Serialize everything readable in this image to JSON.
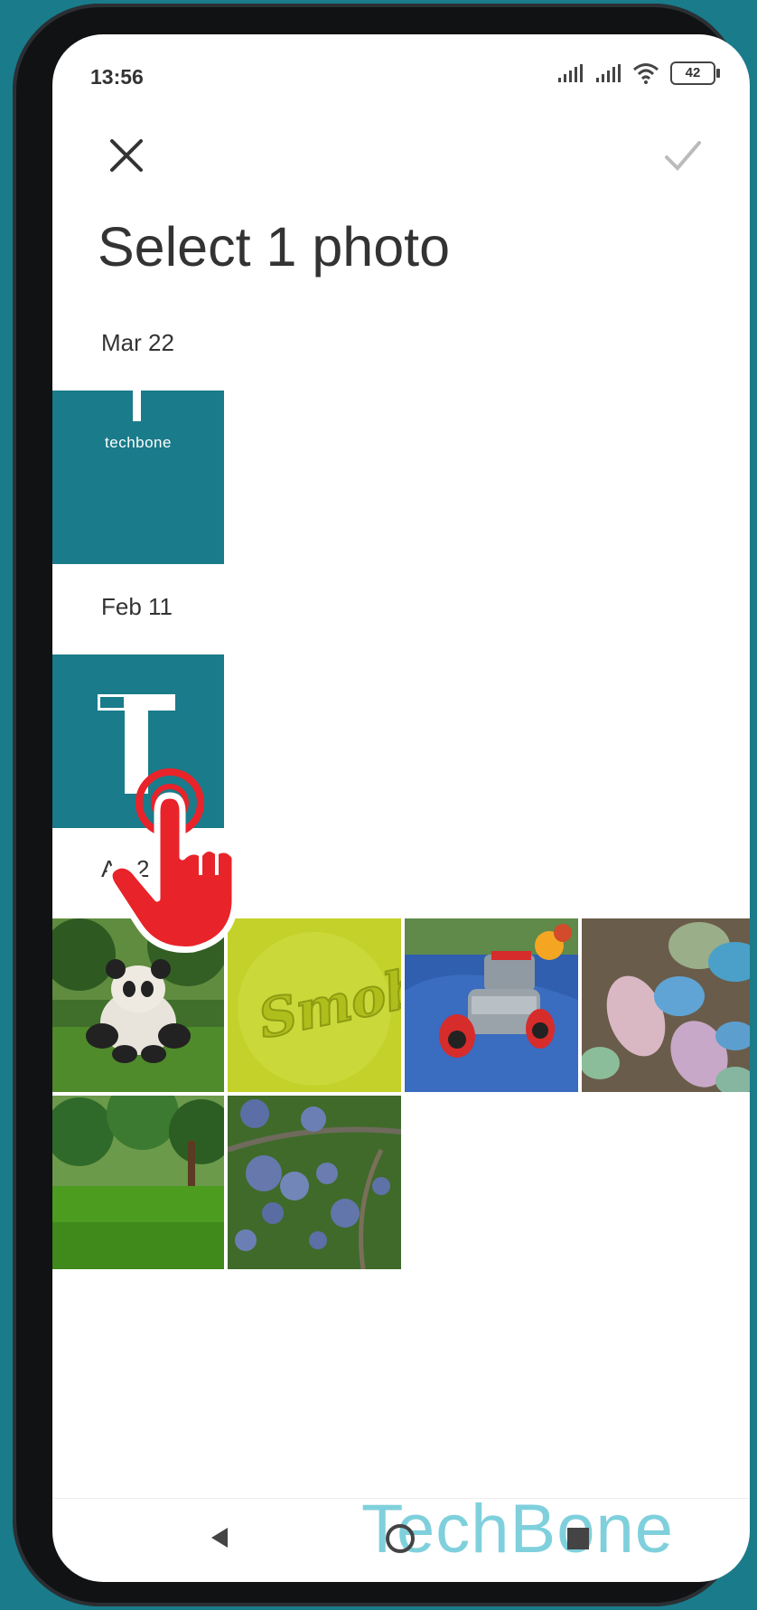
{
  "status": {
    "time": "13:56",
    "battery": "42"
  },
  "header": {
    "title": "Select 1 photo"
  },
  "sections": [
    {
      "label": "Mar 22",
      "photos": [
        {
          "brand_text": "techbone"
        }
      ]
    },
    {
      "label": "Feb 11",
      "photos": [
        {
          "brand_text": ""
        }
      ]
    },
    {
      "label": "Au 2",
      "photos": [
        {
          "subject": "panda plush on grass"
        },
        {
          "subject": "Smoby green plastic"
        },
        {
          "subject": "red toy car on blue tarp"
        },
        {
          "subject": "colored chalk stones"
        },
        {
          "subject": "green lawn with trees"
        },
        {
          "subject": "plums on branch"
        }
      ]
    }
  ],
  "smoby_text": "Smoby",
  "watermark": "TechBone",
  "icons": {
    "close": "close-icon",
    "confirm": "check-icon",
    "back": "back-icon",
    "home": "home-icon",
    "recents": "recents-icon",
    "tap": "tap-hand-icon"
  },
  "colors": {
    "accent": "#1a7b8a",
    "tap_red": "#e8232a",
    "watermark": "#7fd0dc"
  }
}
